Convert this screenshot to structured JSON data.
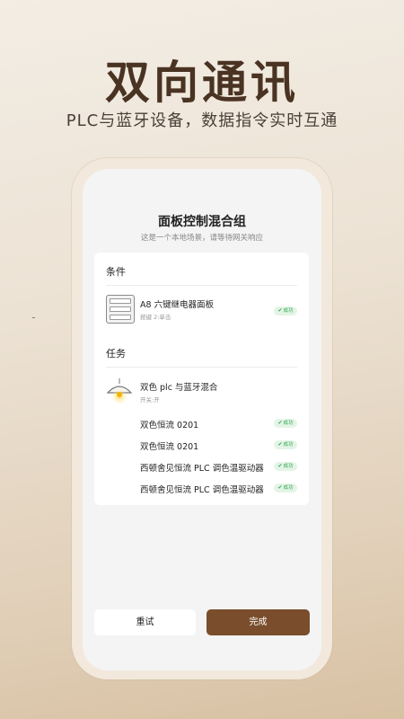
{
  "hero": {
    "title": "双向通讯",
    "subtitle": "PLC与蓝牙设备，数据指令实时互通"
  },
  "scene": {
    "title": "面板控制混合组",
    "subtitle": "这是一个本地场景，请等待网关响应"
  },
  "conditions": {
    "label": "条件",
    "items": [
      {
        "name": "A8 六键继电器面板",
        "sub": "按键 2:单击",
        "status": "成功",
        "icon": "panel-icon"
      }
    ]
  },
  "tasks": {
    "label": "任务",
    "group": {
      "name": "双色 plc 与蓝牙混合",
      "sub": "开关:开",
      "icon": "lamp-icon"
    },
    "items": [
      {
        "name": "双色恒流 0201",
        "status": "成功"
      },
      {
        "name": "双色恒流 0201",
        "status": "成功"
      },
      {
        "name": "西顿舍见恒流 PLC 调色温驱动器",
        "status": "成功"
      },
      {
        "name": "西顿舍见恒流 PLC 调色温驱动器",
        "status": "成功"
      }
    ]
  },
  "actions": {
    "retry_label": "重试",
    "done_label": "完成"
  },
  "colors": {
    "accent": "#7a4e2c",
    "success_bg": "#e3f5e6",
    "success_text": "#3aa657",
    "hero_title": "#4a3322"
  }
}
